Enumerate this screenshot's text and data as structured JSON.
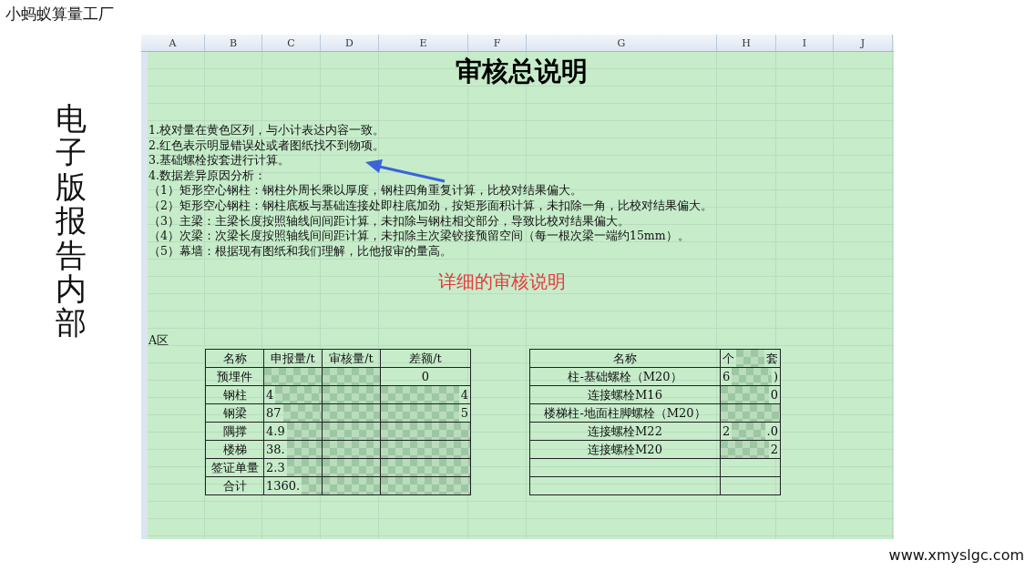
{
  "brand": "小蚂蚁算量工厂",
  "side_caption": "电子版报告内部",
  "sheet": {
    "columns": [
      "A",
      "B",
      "C",
      "D",
      "E",
      "F",
      "G",
      "H",
      "I",
      "J"
    ],
    "title": "审核总说明",
    "notes": [
      "1.校对量在黄色区列，与小计表达内容一致。",
      "2.红色表示明显错误处或者图纸找不到物项。",
      "3.基础螺栓按套进行计算。",
      "4.数据差异原因分析：",
      "（1）矩形空心钢柱：钢柱外周长乘以厚度，钢柱四角重复计算，比校对结果偏大。",
      "（2）矩形空心钢柱：钢柱底板与基础连接处即柱底加劲，按矩形面积计算，未扣除一角，比校对结果偏大。",
      "（3）主梁：主梁长度按照轴线间间距计算，未扣除与钢柱相交部分，导致比校对结果偏大。",
      "（4）次梁：次梁长度按照轴线间间距计算，未扣除主次梁铰接预留空间（每一根次梁一端约15mm）。",
      "（5）幕墙：根据现有图纸和我们理解，比他报审的量高。"
    ],
    "annotation": "详细的审核说明",
    "area_label": "A区",
    "table_1": {
      "rows": [
        {
          "cells": [
            {
              "blur": false,
              "text": "名称"
            },
            {
              "blur": false,
              "text": "申报量/t"
            },
            {
              "blur": false,
              "text": "审核量/t"
            },
            {
              "blur": false,
              "text": "差额/t"
            }
          ]
        },
        {
          "cells": [
            {
              "blur": false,
              "text": "预埋件"
            },
            {
              "blur": true
            },
            {
              "blur": true
            },
            {
              "blur": false,
              "text": "0"
            }
          ]
        },
        {
          "cells": [
            {
              "blur": false,
              "text": "钢柱"
            },
            {
              "blur": true,
              "before": "4"
            },
            {
              "blur": true
            },
            {
              "blur": true,
              "after": "4"
            }
          ]
        },
        {
          "cells": [
            {
              "blur": false,
              "text": "钢梁"
            },
            {
              "blur": true,
              "before": "87"
            },
            {
              "blur": true
            },
            {
              "blur": true,
              "after": "5"
            }
          ]
        },
        {
          "cells": [
            {
              "blur": false,
              "text": "隅撑"
            },
            {
              "blur": true,
              "before": "4.9"
            },
            {
              "blur": true
            },
            {
              "blur": true
            }
          ]
        },
        {
          "cells": [
            {
              "blur": false,
              "text": "楼梯"
            },
            {
              "blur": true,
              "before": "38."
            },
            {
              "blur": true
            },
            {
              "blur": true
            }
          ]
        },
        {
          "cells": [
            {
              "blur": false,
              "text": "签证单量"
            },
            {
              "blur": true,
              "before": "2.3"
            },
            {
              "blur": true
            },
            {
              "blur": true
            }
          ]
        },
        {
          "cells": [
            {
              "blur": false,
              "text": "合计"
            },
            {
              "blur": true,
              "before": "1360."
            },
            {
              "blur": true
            },
            {
              "blur": true
            }
          ]
        }
      ]
    },
    "table_2": {
      "rows": [
        {
          "cells": [
            {
              "blur": false,
              "text": "名称"
            },
            {
              "blur": true,
              "before": "个",
              "after": "套"
            }
          ]
        },
        {
          "cells": [
            {
              "blur": false,
              "text": "柱-基础螺栓（M20）"
            },
            {
              "blur": true,
              "before": "6",
              "after": ")"
            }
          ]
        },
        {
          "cells": [
            {
              "blur": false,
              "text": "连接螺栓M16"
            },
            {
              "blur": true,
              "after": "0"
            }
          ]
        },
        {
          "cells": [
            {
              "blur": false,
              "text": "楼梯柱-地面柱脚螺栓（M20）"
            },
            {
              "blur": true
            }
          ]
        },
        {
          "cells": [
            {
              "blur": false,
              "text": "连接螺栓M22"
            },
            {
              "blur": true,
              "before": "2",
              "after": ".0"
            }
          ]
        },
        {
          "cells": [
            {
              "blur": false,
              "text": "连接螺栓M20"
            },
            {
              "blur": true,
              "after": "2"
            }
          ]
        },
        {
          "cells": [
            {
              "blur": false
            },
            {
              "blur": false
            }
          ]
        },
        {
          "cells": [
            {
              "blur": false
            },
            {
              "blur": false
            }
          ]
        }
      ]
    }
  },
  "footer": "www.xmyslgc.com"
}
